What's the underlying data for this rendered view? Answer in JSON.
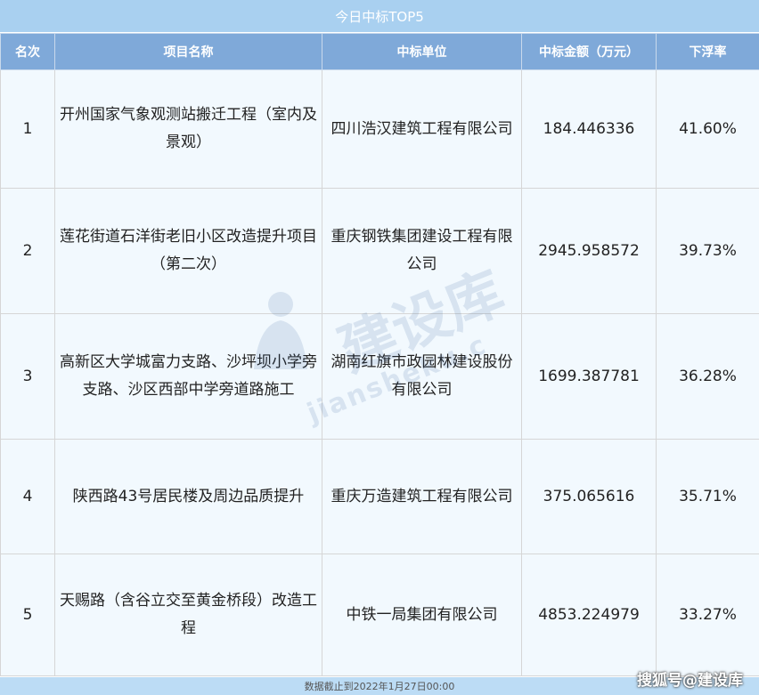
{
  "title": "今日中标TOP5",
  "columns": [
    "名次",
    "项目名称",
    "中标单位",
    "中标金额（万元）",
    "下浮率"
  ],
  "rows": [
    {
      "rank": "1",
      "project": "开州国家气象观测站搬迁工程（室内及景观）",
      "winner": "四川浩汉建筑工程有限公司",
      "amount": "184.446336",
      "rate": "41.60%"
    },
    {
      "rank": "2",
      "project": "莲花街道石洋街老旧小区改造提升项目（第二次）",
      "winner": "重庆钢铁集团建设工程有限公司",
      "amount": "2945.958572",
      "rate": "39.73%"
    },
    {
      "rank": "3",
      "project": "高新区大学城富力支路、沙坪坝小学旁支路、沙区西部中学旁道路施工",
      "winner": "湖南红旗市政园林建设股份有限公司",
      "amount": "1699.387781",
      "rate": "36.28%"
    },
    {
      "rank": "4",
      "project": "陕西路43号居民楼及周边品质提升",
      "winner": "重庆万造建筑工程有限公司",
      "amount": "375.065616",
      "rate": "35.71%"
    },
    {
      "rank": "5",
      "project": "天赐路（含谷立交至黄金桥段）改造工程",
      "winner": "中铁一局集团有限公司",
      "amount": "4853.224979",
      "rate": "33.27%"
    }
  ],
  "footer": "数据截止到2022年1月27日00:00",
  "source": "搜狐号@建设库",
  "watermark": {
    "main": "建设库",
    "sub": "jiansheku.c"
  }
}
